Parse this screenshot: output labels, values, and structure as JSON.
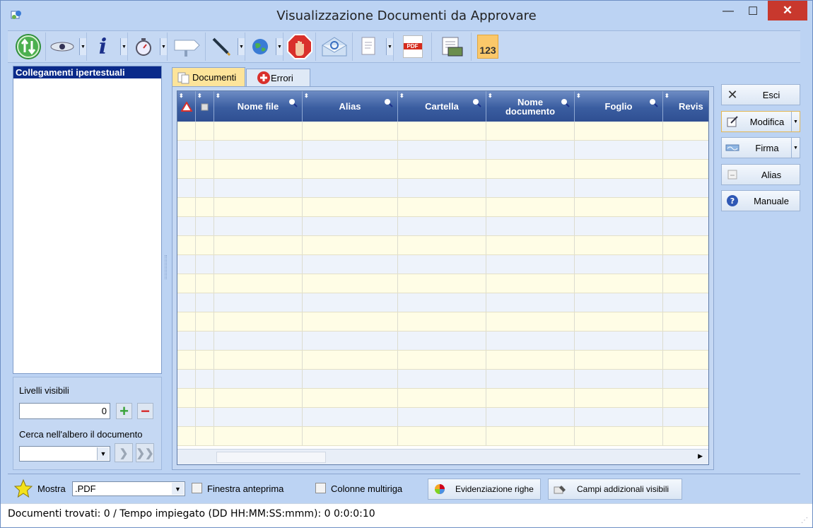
{
  "window": {
    "title": "Visualizzazione Documenti da Approvare",
    "min_glyph": "—",
    "max_glyph": "☐",
    "close_glyph": "✕"
  },
  "left": {
    "tree_header": "Collegamenti ipertestuali",
    "levels_label": "Livelli visibili",
    "levels_value": "0",
    "search_label": "Cerca nell'albero il documento",
    "search_value": ""
  },
  "tabs": [
    {
      "label": "Documenti",
      "active": true
    },
    {
      "label": "Errori",
      "active": false
    }
  ],
  "grid": {
    "columns": [
      "",
      "",
      "Nome file",
      "Alias",
      "Cartella",
      "Nome documento",
      "Foglio",
      "Revis"
    ],
    "row_count": 17
  },
  "actions": {
    "esci": "Esci",
    "modifica": "Modifica",
    "firma": "Firma",
    "alias": "Alias",
    "manuale": "Manuale"
  },
  "bottom": {
    "mostra_label": "Mostra",
    "mostra_value": ".PDF",
    "finestra_anteprima": "Finestra anteprima",
    "colonne_multiriga": "Colonne multiriga",
    "evidenziazione": "Evidenziazione righe",
    "campi_addizionali": "Campi addizionali visibili"
  },
  "status": "Documenti trovati: 0 / Tempo impiegato (DD HH:MM:SS:mmm):  0 0:0:0:10",
  "toolbar_icons": [
    "refresh-icon",
    "eye-icon",
    "info-icon",
    "timer-icon",
    "signpost-icon",
    "pen-icon",
    "globe-icon",
    "stop-hand-icon",
    "email-icon",
    "document-icon",
    "pdf-icon",
    "print-preview-icon",
    "counter-icon"
  ],
  "toolbar_text": {
    "info": "i",
    "pdf": "PDF",
    "counter": "123"
  },
  "colors": {
    "window_bg": "#bcd3f3",
    "header_blue": "#3a5da0",
    "row_odd": "#fffde6",
    "row_even": "#eef3fb",
    "close_red": "#c8382d"
  }
}
